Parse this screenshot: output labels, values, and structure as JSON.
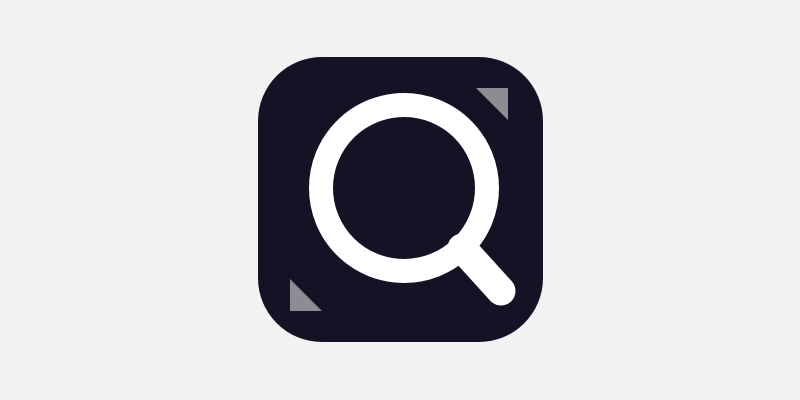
{
  "colors": {
    "background": "#f2f2f2",
    "icon_background": "#171125",
    "glyph": "#ffffff",
    "corner_marks": "#8e8c93"
  },
  "icon": {
    "name": "magnifying-glass-icon"
  }
}
